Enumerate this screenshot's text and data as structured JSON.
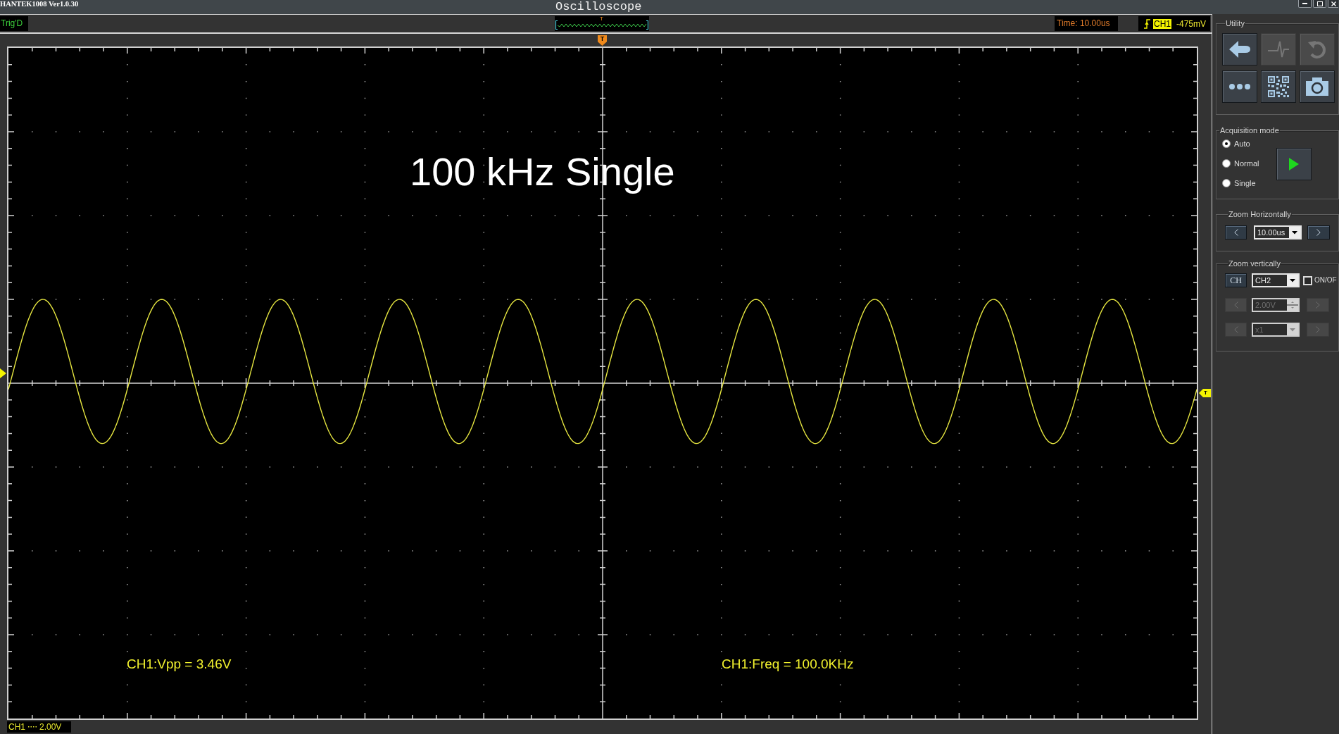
{
  "window": {
    "app_version": "HANTEK1008 Ver1.0.30",
    "title": "Oscilloscope"
  },
  "status_bar": {
    "trigger_status": "Trig'D",
    "trigger_overview": {
      "marker": "T"
    },
    "timebase": "Time: 10.00us",
    "trigger": {
      "channel": "CH1",
      "level": "-475mV"
    }
  },
  "screen": {
    "annotation": "100 kHz Single",
    "trigger_position_marker": "T",
    "trigger_level_marker": "T",
    "measurements": [
      "CH1:Vpp = 3.46V",
      "CH1:Freq = 100.0KHz"
    ]
  },
  "channel_label": {
    "channel": "CH1",
    "scale": "2.00V"
  },
  "panel": {
    "utility": {
      "title": "Utility",
      "buttons": [
        {
          "disabled": false
        },
        {
          "disabled": true
        },
        {
          "disabled": true
        },
        {
          "disabled": false
        },
        {
          "disabled": false
        },
        {
          "disabled": false
        }
      ]
    },
    "acquisition_mode": {
      "title": "Acquisition mode",
      "options": [
        {
          "label": "Auto",
          "selected": true
        },
        {
          "label": "Normal",
          "selected": false
        },
        {
          "label": "Single",
          "selected": false
        }
      ]
    },
    "zoom_horizontally": {
      "title": "Zoom Horizontally",
      "value": "10.00us"
    },
    "zoom_vertically": {
      "title": "Zoom vertically",
      "channel_button": "CH",
      "channel": "CH2",
      "on_off": {
        "label": "ON/OF",
        "checked": false
      },
      "scale": {
        "value": "2.00V",
        "disabled": true
      },
      "probe": {
        "value": "x1",
        "disabled": true
      }
    }
  }
}
